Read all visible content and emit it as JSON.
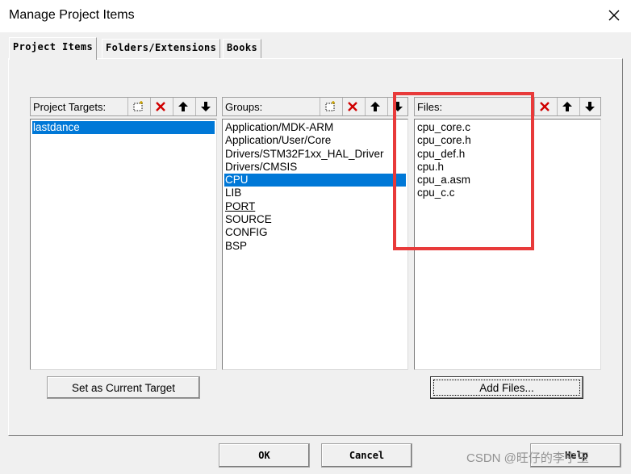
{
  "window": {
    "title": "Manage Project Items"
  },
  "tabs": [
    "Project Items",
    "Folders/Extensions",
    "Books"
  ],
  "targets": {
    "label": "Project Targets:",
    "items": [
      "lastdance"
    ],
    "set_current_label": "Set as Current Target"
  },
  "groups": {
    "label": "Groups:",
    "items": [
      "Application/MDK-ARM",
      "Application/User/Core",
      "Drivers/STM32F1xx_HAL_Driver",
      "Drivers/CMSIS",
      "CPU",
      "LIB",
      "PORT",
      "SOURCE",
      "CONFIG",
      "BSP"
    ]
  },
  "files": {
    "label": "Files:",
    "items": [
      "cpu_core.c",
      "cpu_core.h",
      "cpu_def.h",
      "cpu.h",
      "cpu_a.asm",
      "cpu_c.c"
    ],
    "add_label": "Add Files..."
  },
  "footer": {
    "ok": "OK",
    "cancel": "Cancel",
    "help": "Help"
  },
  "watermark": "CSDN @旺仔的李宁玉",
  "colors": {
    "selection": "#0078d7",
    "highlight_border": "#e83a3a"
  }
}
